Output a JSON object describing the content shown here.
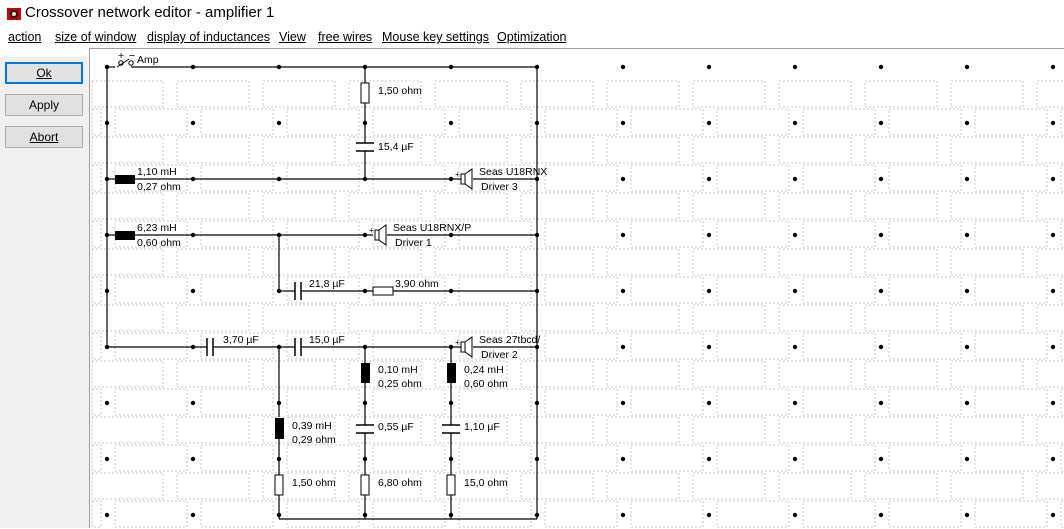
{
  "window": {
    "title": "Crossover network editor - amplifier 1"
  },
  "menu": [
    {
      "label": "action"
    },
    {
      "label": "size of window"
    },
    {
      "label": "display of inductances"
    },
    {
      "label": "View"
    },
    {
      "label": "free wires"
    },
    {
      "label": "Mouse key settings"
    },
    {
      "label": "Optimization"
    }
  ],
  "buttons": {
    "ok": "Ok",
    "apply": "Apply",
    "abort": "Abort"
  },
  "colors": {
    "wire": "#000000",
    "grid": "#c8c8c8",
    "panel": "#f0f0f0",
    "focus": "#0078d7"
  },
  "circuit": {
    "amp": {
      "label": "Amp",
      "plus": "+",
      "minus": "−"
    },
    "components": [
      {
        "id": "R1",
        "type": "resistor",
        "value": "1,50 ohm"
      },
      {
        "id": "C1",
        "type": "capacitor",
        "value": "15,4 µF"
      },
      {
        "id": "L1",
        "type": "inductor",
        "value": "1,10 mH",
        "resistance": "0,27 ohm"
      },
      {
        "id": "L2",
        "type": "inductor",
        "value": "6,23 mH",
        "resistance": "0,60 ohm"
      },
      {
        "id": "C2",
        "type": "capacitor",
        "value": "21,8 µF"
      },
      {
        "id": "R2",
        "type": "resistor",
        "value": "3,90 ohm"
      },
      {
        "id": "C3",
        "type": "capacitor",
        "value": "3,70 µF"
      },
      {
        "id": "C4",
        "type": "capacitor",
        "value": "15,0 µF"
      },
      {
        "id": "L3",
        "type": "inductor",
        "value": "0,10 mH",
        "resistance": "0,25 ohm"
      },
      {
        "id": "L4",
        "type": "inductor",
        "value": "0,24 mH",
        "resistance": "0,60 ohm"
      },
      {
        "id": "L5",
        "type": "inductor",
        "value": "0,39 mH",
        "resistance": "0,29 ohm"
      },
      {
        "id": "C5",
        "type": "capacitor",
        "value": "0,55 µF"
      },
      {
        "id": "C6",
        "type": "capacitor",
        "value": "1,10 µF"
      },
      {
        "id": "R3",
        "type": "resistor",
        "value": "1,50 ohm"
      },
      {
        "id": "R4",
        "type": "resistor",
        "value": "6,80 ohm"
      },
      {
        "id": "R5",
        "type": "resistor",
        "value": "15,0 ohm"
      }
    ],
    "drivers": [
      {
        "model": "Seas U18RNX",
        "name": "Driver 3"
      },
      {
        "model": "Seas U18RNX/P",
        "name": "Driver 1"
      },
      {
        "model": "Seas 27tbcd/",
        "name": "Driver 2"
      }
    ]
  }
}
